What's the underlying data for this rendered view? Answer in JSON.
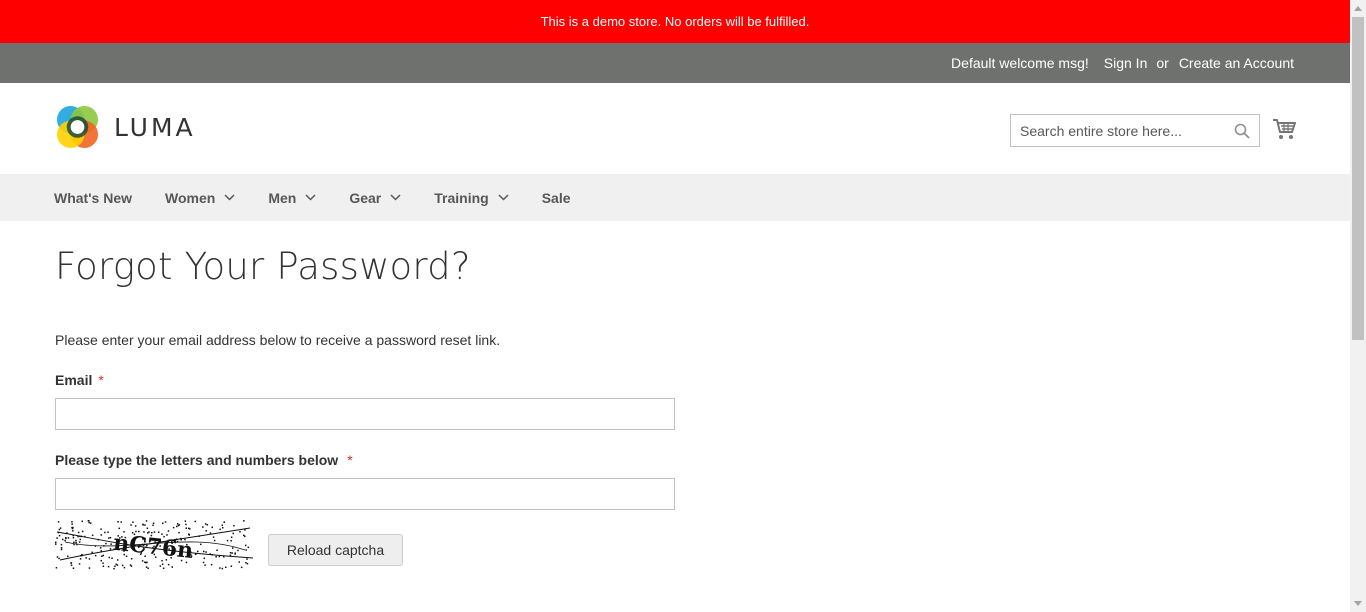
{
  "demo_notice": "This is a demo store. No orders will be fulfilled.",
  "panel": {
    "welcome": "Default welcome msg!",
    "sign_in": "Sign In",
    "or": "or",
    "create_account": "Create an Account"
  },
  "header": {
    "logo_text": "LUMA",
    "search_placeholder": "Search entire store here...",
    "search_value": ""
  },
  "nav": {
    "items": [
      {
        "label": "What's New",
        "has_dropdown": false
      },
      {
        "label": "Women",
        "has_dropdown": true
      },
      {
        "label": "Men",
        "has_dropdown": true
      },
      {
        "label": "Gear",
        "has_dropdown": true
      },
      {
        "label": "Training",
        "has_dropdown": true
      },
      {
        "label": "Sale",
        "has_dropdown": false
      }
    ]
  },
  "form": {
    "title": "Forgot Your Password?",
    "intro": "Please enter your email address below to receive a password reset link.",
    "email_label": "Email",
    "email_value": "",
    "captcha_label": "Please type the letters and numbers below",
    "captcha_value": "",
    "captcha_text": "nC76n",
    "required_mark": "*",
    "reload_label": "Reload captcha"
  },
  "colors": {
    "demo_bar": "#ff0000",
    "panel_bar": "#6e716e",
    "nav_bar": "#f0f0f0",
    "required": "#e02b27"
  }
}
